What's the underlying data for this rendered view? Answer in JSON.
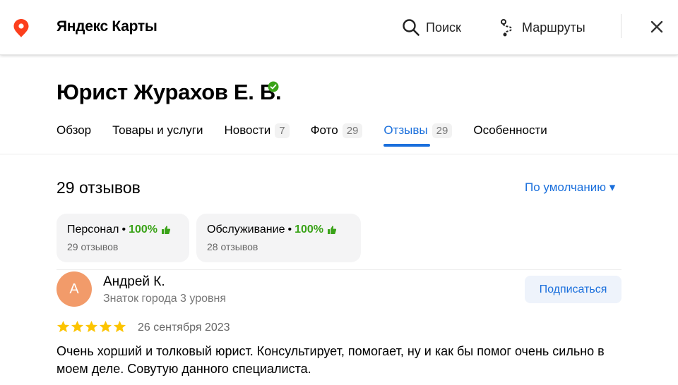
{
  "header": {
    "brand": "Яндекс Карты",
    "search_label": "Поиск",
    "routes_label": "Маршруты",
    "accent_color": "#ff3333"
  },
  "organization": {
    "title": "Юрист Журахов Е. В.",
    "verified": true
  },
  "tabs": [
    {
      "label": "Обзор",
      "count": null,
      "active": false
    },
    {
      "label": "Товары и услуги",
      "count": null,
      "active": false
    },
    {
      "label": "Новости",
      "count": "7",
      "active": false
    },
    {
      "label": "Фото",
      "count": "29",
      "active": false
    },
    {
      "label": "Отзывы",
      "count": "29",
      "active": true
    },
    {
      "label": "Особенности",
      "count": null,
      "active": false
    }
  ],
  "reviews": {
    "count_label": "29 отзывов",
    "sort_label": "По умолчанию ▾",
    "aspects": [
      {
        "name": "Персонал",
        "separator": "•",
        "percent": "100%",
        "sub": "29 отзывов"
      },
      {
        "name": "Обслуживание",
        "separator": "•",
        "percent": "100%",
        "sub": "28 отзывов"
      }
    ],
    "items": [
      {
        "avatar_letter": "А",
        "avatar_color": "#f29b6a",
        "author": "Андрей К.",
        "level": "Знаток города 3 уровня",
        "subscribe_label": "Подписаться",
        "rating": 5,
        "date": "26 сентября 2023",
        "text": "Очень хорший и толковый юрист. Консультирует, помогает, ну и как бы помог очень сильно в моем деле. Совутую данного специалиста."
      }
    ]
  },
  "colors": {
    "link": "#1a6fdc",
    "positive": "#3aa318",
    "star": "#fcc400"
  }
}
